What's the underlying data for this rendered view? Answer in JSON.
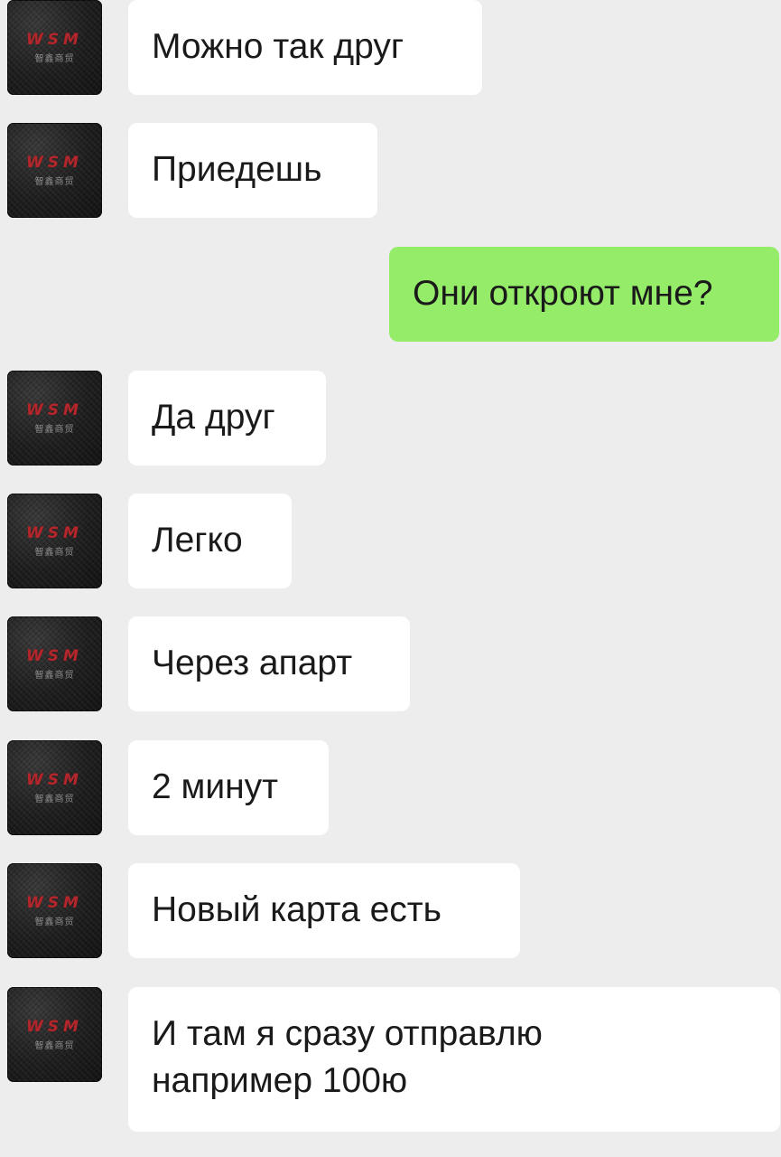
{
  "avatar": {
    "logo_text": "WSM",
    "sub_text": "智鑫商贸",
    "icon": "contact-avatar-icon"
  },
  "colors": {
    "background": "#ededed",
    "incoming_bubble": "#ffffff",
    "outgoing_bubble": "#95ec69",
    "avatar_logo": "#b3272c"
  },
  "messages": [
    {
      "direction": "incoming",
      "text": "Можно так друг"
    },
    {
      "direction": "incoming",
      "text": "Приедешь"
    },
    {
      "direction": "outgoing",
      "text": "Они откроют мне?"
    },
    {
      "direction": "incoming",
      "text": "Да друг"
    },
    {
      "direction": "incoming",
      "text": "Легко"
    },
    {
      "direction": "incoming",
      "text": "Через апарт"
    },
    {
      "direction": "incoming",
      "text": "2 минут"
    },
    {
      "direction": "incoming",
      "text": "Новый карта есть"
    },
    {
      "direction": "incoming",
      "text": "И там я сразу отправлю например 100ю"
    }
  ]
}
